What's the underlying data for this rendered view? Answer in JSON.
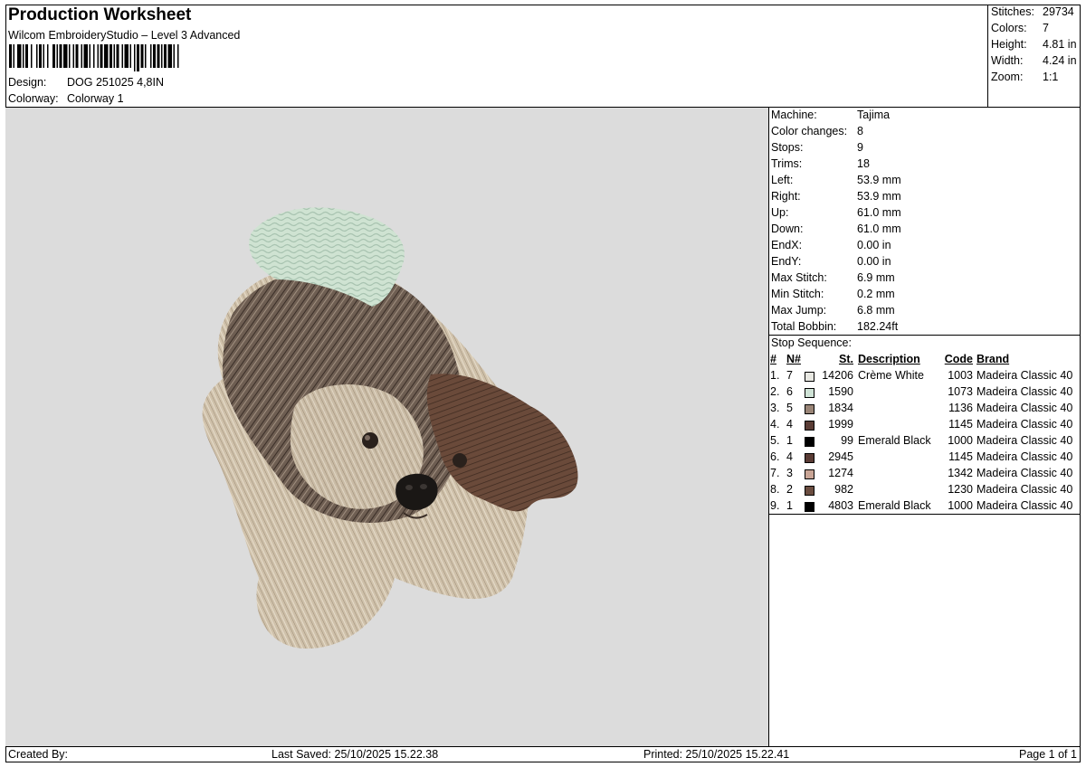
{
  "header": {
    "title": "Production Worksheet",
    "software": "Wilcom EmbroideryStudio – Level 3 Advanced",
    "design_label": "Design:",
    "design_value": "DOG 251025 4,8IN",
    "colorway_label": "Colorway:",
    "colorway_value": "Colorway 1"
  },
  "stats": [
    {
      "label": "Stitches:",
      "value": "29734"
    },
    {
      "label": "Colors:",
      "value": "7"
    },
    {
      "label": "Height:",
      "value": "4.81 in"
    },
    {
      "label": "Width:",
      "value": "4.24 in"
    },
    {
      "label": "Zoom:",
      "value": "1:1"
    }
  ],
  "machine_info": [
    {
      "label": "Machine:",
      "value": "Tajima"
    },
    {
      "label": "Color changes:",
      "value": "8"
    },
    {
      "label": "Stops:",
      "value": "9"
    },
    {
      "label": "Trims:",
      "value": "18"
    },
    {
      "label": "Left:",
      "value": "53.9 mm"
    },
    {
      "label": "Right:",
      "value": "53.9 mm"
    },
    {
      "label": "Up:",
      "value": "61.0 mm"
    },
    {
      "label": "Down:",
      "value": "61.0 mm"
    },
    {
      "label": "EndX:",
      "value": "0.00 in"
    },
    {
      "label": "EndY:",
      "value": "0.00 in"
    },
    {
      "label": "Max Stitch:",
      "value": "6.9 mm"
    },
    {
      "label": "Min Stitch:",
      "value": "0.2 mm"
    },
    {
      "label": "Max Jump:",
      "value": "6.8 mm"
    },
    {
      "label": "Total Bobbin:",
      "value": "182.24ft"
    }
  ],
  "stop_sequence": {
    "title": "Stop Sequence:",
    "columns": {
      "idx": "#",
      "n": "N#",
      "st": "St.",
      "desc": "Description",
      "code": "Code",
      "brand": "Brand"
    },
    "rows": [
      {
        "idx": "1.",
        "n": "7",
        "color": "#e8e8e2",
        "st": "14206",
        "desc": "Crème White",
        "code": "1003",
        "brand": "Madeira Classic 40"
      },
      {
        "idx": "2.",
        "n": "6",
        "color": "#cfe3d6",
        "st": "1590",
        "desc": "",
        "code": "1073",
        "brand": "Madeira Classic 40"
      },
      {
        "idx": "3.",
        "n": "5",
        "color": "#9a8577",
        "st": "1834",
        "desc": "",
        "code": "1136",
        "brand": "Madeira Classic 40"
      },
      {
        "idx": "4.",
        "n": "4",
        "color": "#5a3c35",
        "st": "1999",
        "desc": "",
        "code": "1145",
        "brand": "Madeira Classic 40"
      },
      {
        "idx": "5.",
        "n": "1",
        "color": "#000000",
        "st": "99",
        "desc": "Emerald Black",
        "code": "1000",
        "brand": "Madeira Classic 40"
      },
      {
        "idx": "6.",
        "n": "4",
        "color": "#5a3c35",
        "st": "2945",
        "desc": "",
        "code": "1145",
        "brand": "Madeira Classic 40"
      },
      {
        "idx": "7.",
        "n": "3",
        "color": "#c9a596",
        "st": "1274",
        "desc": "",
        "code": "1342",
        "brand": "Madeira Classic 40"
      },
      {
        "idx": "8.",
        "n": "2",
        "color": "#6b4d40",
        "st": "982",
        "desc": "",
        "code": "1230",
        "brand": "Madeira Classic 40"
      },
      {
        "idx": "9.",
        "n": "1",
        "color": "#000000",
        "st": "4803",
        "desc": "Emerald Black",
        "code": "1000",
        "brand": "Madeira Classic 40"
      }
    ]
  },
  "footer": {
    "created_by": "Created By:",
    "last_saved": "Last Saved: 25/10/2025 15.22.38",
    "printed": "Printed: 25/10/2025 15.22.41",
    "page": "Page 1 of 1"
  },
  "colors": {
    "preview_bg": "#dcdcdc",
    "fur_dark": "#4a3a30",
    "fur_light": "#d8ccb6",
    "bow": "#cfe3d2"
  }
}
